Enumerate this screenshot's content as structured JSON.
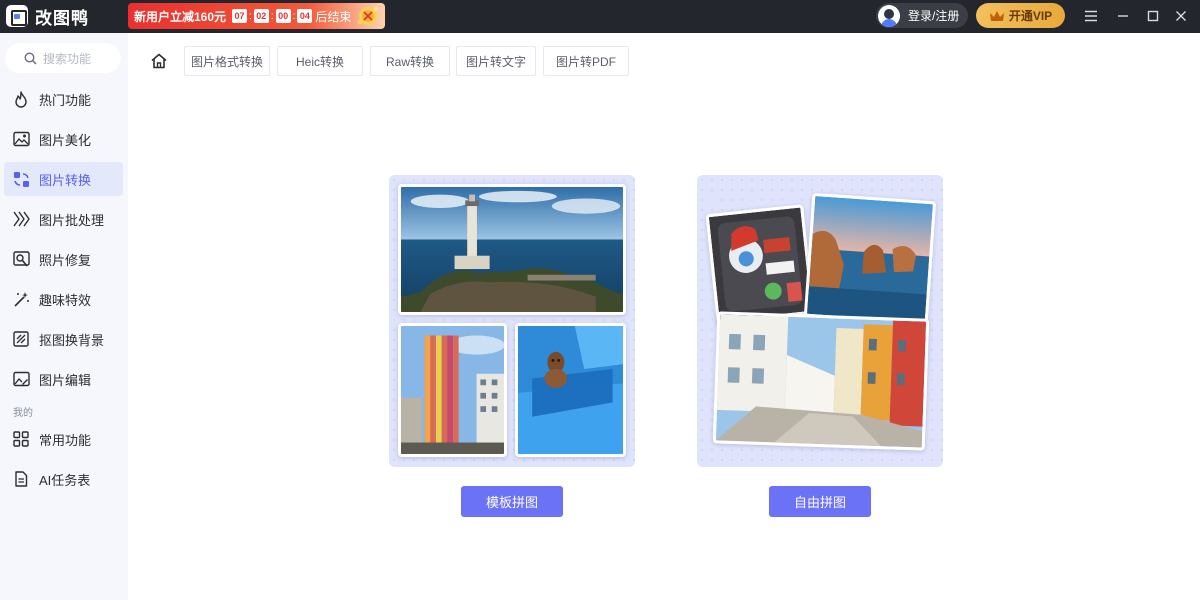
{
  "app": {
    "name": "改图鸭"
  },
  "promo": {
    "text": "新用户立减160元",
    "timer": [
      "07",
      "02",
      "00",
      "04"
    ],
    "suffix": "后结束"
  },
  "header": {
    "login_label": "登录/注册",
    "vip_label": "开通VIP"
  },
  "sidebar": {
    "search_placeholder": "搜索功能",
    "items": [
      {
        "label": "热门功能",
        "icon": "flame-icon"
      },
      {
        "label": "图片美化",
        "icon": "image-beautify-icon"
      },
      {
        "label": "图片转换",
        "icon": "convert-icon",
        "active": true
      },
      {
        "label": "图片批处理",
        "icon": "batch-icon"
      },
      {
        "label": "照片修复",
        "icon": "photo-repair-icon"
      },
      {
        "label": "趣味特效",
        "icon": "magic-wand-icon"
      },
      {
        "label": "抠图换背景",
        "icon": "cutout-icon"
      },
      {
        "label": "图片编辑",
        "icon": "image-edit-icon"
      }
    ],
    "section_mine": "我的",
    "mine_items": [
      {
        "label": "常用功能",
        "icon": "grid-icon"
      },
      {
        "label": "AI任务表",
        "icon": "task-list-icon"
      }
    ]
  },
  "tabs": [
    "图片格式转换",
    "Heic转换",
    "Raw转换",
    "图片转文字",
    "图片转PDF"
  ],
  "cards": {
    "template_label": "模板拼图",
    "free_label": "自由拼图"
  },
  "colors": {
    "titlebar": "#23262d",
    "accent": "#6c72f5",
    "active_nav_bg": "#e4e8fb",
    "card_bg": "#dfe3fb"
  }
}
